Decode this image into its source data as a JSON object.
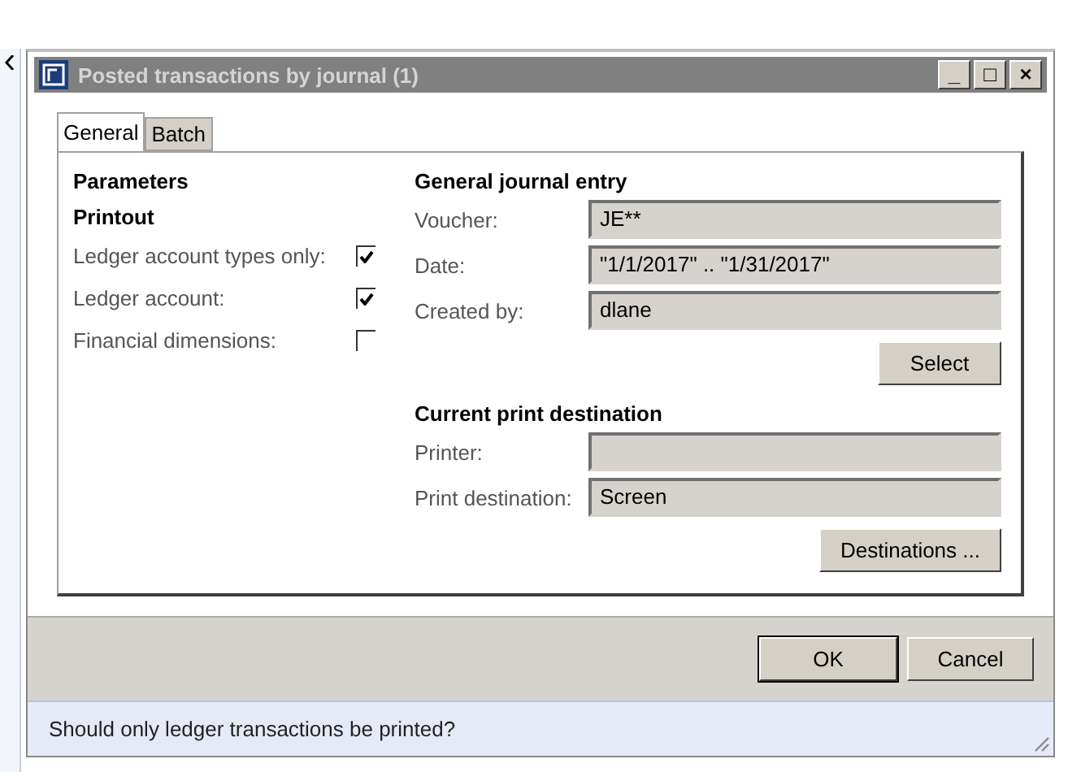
{
  "window": {
    "title": "Posted transactions by journal (1)",
    "controls": [
      "_",
      "□",
      "×"
    ]
  },
  "tabs": [
    {
      "label": "General",
      "selected": true
    },
    {
      "label": "Batch",
      "selected": false
    }
  ],
  "parameters": {
    "heading": "Parameters",
    "subheading": "Printout",
    "options": [
      {
        "label": "Ledger account types only:",
        "checked": true
      },
      {
        "label": "Ledger account:",
        "checked": true
      },
      {
        "label": "Financial dimensions:",
        "checked": false
      }
    ]
  },
  "journal_entry": {
    "heading": "General journal entry",
    "fields": [
      {
        "label": "Voucher:",
        "value": "JE**"
      },
      {
        "label": "Date:",
        "value": "\"1/1/2017\" .. \"1/31/2017\""
      },
      {
        "label": "Created by:",
        "value": "dlane"
      }
    ],
    "button": "Select"
  },
  "print_destination": {
    "heading": "Current print destination",
    "fields": [
      {
        "label": "Printer:"
      },
      {
        "label": "Print destination:",
        "value": "Screen"
      }
    ],
    "button": "Destinations ..."
  },
  "buttons": [
    "OK",
    "Cancel"
  ],
  "status_bar": "Should only ledger transactions be printed?"
}
